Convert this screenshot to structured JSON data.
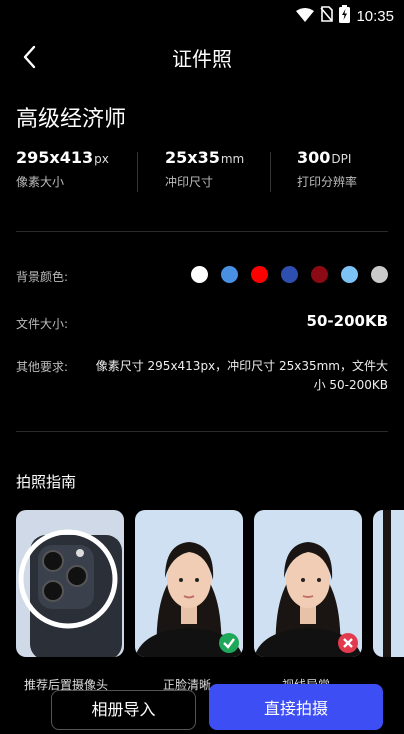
{
  "status": {
    "time": "10:35"
  },
  "header": {
    "title": "证件照"
  },
  "spec_name": "高级经济师",
  "specs": [
    {
      "value": "295x413",
      "unit": "px",
      "label": "像素大小"
    },
    {
      "value": "25x35",
      "unit": "mm",
      "label": "冲印尺寸"
    },
    {
      "value": "300",
      "unit": "DPI",
      "label": "打印分辨率"
    }
  ],
  "details": {
    "bg_label": "背景颜色:",
    "bg_colors": [
      "#ffffff",
      "#4a90e2",
      "#ff0000",
      "#2f4fb0",
      "#8b0a14",
      "#7dc2f5",
      "#c9c9c9"
    ],
    "size_label": "文件大小:",
    "size_value": "50-200KB",
    "other_label": "其他要求:",
    "other_value": "像素尺寸 295x413px，冲印尺寸 25x35mm，文件大小 50-200KB"
  },
  "guide": {
    "title": "拍照指南",
    "cards": [
      {
        "caption": "推荐后置摄像头"
      },
      {
        "caption": "正脸清晰",
        "status": "ok"
      },
      {
        "caption": "视线异常",
        "status": "bad"
      }
    ]
  },
  "actions": {
    "album": "相册导入",
    "shoot": "直接拍摄"
  }
}
